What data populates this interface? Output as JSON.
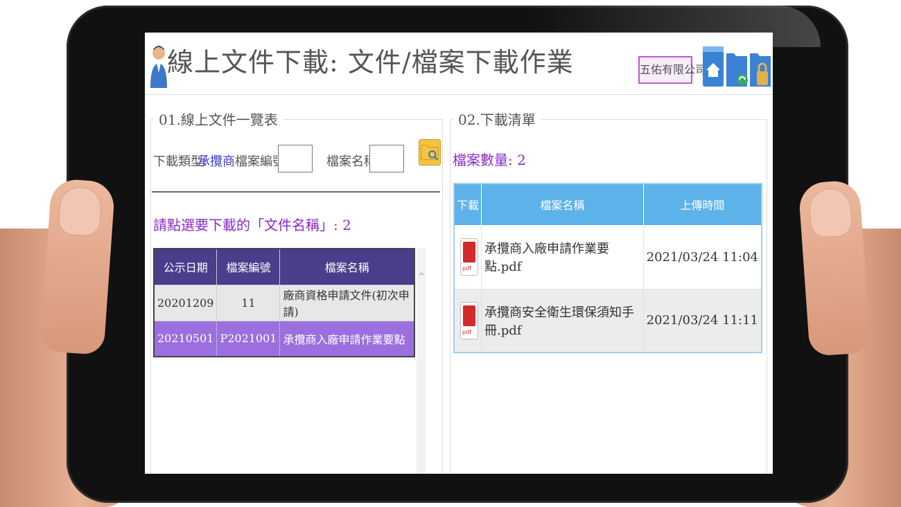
{
  "header": {
    "title": "線上文件下載: 文件/檔案下載作業",
    "company": "五佑有限公司",
    "icons": [
      "user-icon",
      "home-icon",
      "folder-sync-icon",
      "lock-folder-icon"
    ]
  },
  "left_panel": {
    "legend": "01.線上文件一覽表",
    "filter": {
      "type_label": "下載類型:",
      "type_value": "承攬商",
      "doc_no_label": "檔案編號:",
      "doc_no_value": "",
      "file_name_label": "檔案名稱:",
      "file_name_value": ""
    },
    "select_prompt": "請點選要下載的「文件名稱」: 2",
    "table": {
      "headers": [
        "公示日期",
        "檔案編號",
        "檔案名稱"
      ],
      "rows": [
        {
          "date": "20201209",
          "no": "11",
          "name": "廠商資格申請文件(初次申請)"
        },
        {
          "date": "20210501",
          "no": "P2021001",
          "name": "承攬商入廠申請作業要點"
        }
      ]
    },
    "scroll_up_glyph": "^"
  },
  "right_panel": {
    "legend": "02.下載清單",
    "file_count": "檔案數量: 2",
    "table": {
      "headers": [
        "下載",
        "檔案名稱",
        "上傳時間"
      ],
      "rows": [
        {
          "name": "承攬商入廠申請作業要點.pdf",
          "time": "2021/03/24 11:04"
        },
        {
          "name": "承攬商安全衛生環保須知手冊.pdf",
          "time": "2021/03/24 11:11"
        }
      ]
    },
    "pdf_icon_text": "pdf"
  },
  "colors": {
    "accent_purple": "#8a2bc6",
    "table_header_purple": "#4a3d8c",
    "selected_row": "#9b6fdd",
    "download_header_blue": "#5db2ea",
    "company_border": "#c155d8"
  }
}
